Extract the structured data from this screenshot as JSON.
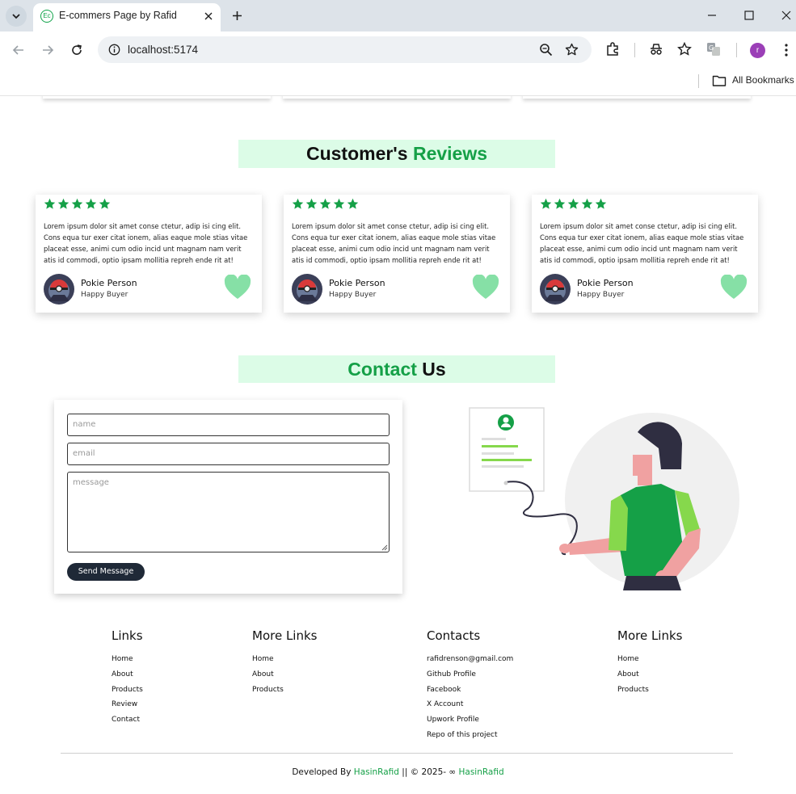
{
  "browser": {
    "tab_title": "E-commers Page by Rafid",
    "favicon_text": "Ec",
    "url": "localhost:5174",
    "bookmarks_label": "All Bookmarks",
    "profile_initial": "r"
  },
  "reviews": {
    "title_part1": "Customer's",
    "title_part2": "Reviews",
    "star_color": "#15a047",
    "cards": [
      {
        "rating": 5,
        "text": "Lorem ipsum dolor sit amet conse ctetur, adip isi cing elit. Cons equa tur exer citat ionem, alias eaque mole stias vitae placeat esse, animi cum odio incid unt magnam nam verit atis id commodi, optio ipsam mollitia repreh ende rit at!",
        "name": "Pokie Person",
        "role": "Happy Buyer"
      },
      {
        "rating": 5,
        "text": "Lorem ipsum dolor sit amet conse ctetur, adip isi cing elit. Cons equa tur exer citat ionem, alias eaque mole stias vitae placeat esse, animi cum odio incid unt magnam nam verit atis id commodi, optio ipsam mollitia repreh ende rit at!",
        "name": "Pokie Person",
        "role": "Happy Buyer"
      },
      {
        "rating": 5,
        "text": "Lorem ipsum dolor sit amet conse ctetur, adip isi cing elit. Cons equa tur exer citat ionem, alias eaque mole stias vitae placeat esse, animi cum odio incid unt magnam nam verit atis id commodi, optio ipsam mollitia repreh ende rit at!",
        "name": "Pokie Person",
        "role": "Happy Buyer"
      }
    ]
  },
  "contact": {
    "title_part1": "Contact",
    "title_part2": "Us",
    "name_placeholder": "name",
    "email_placeholder": "email",
    "message_placeholder": "message",
    "send_label": "Send Message"
  },
  "footer": {
    "columns": [
      {
        "heading": "Links",
        "items": [
          "Home",
          "About",
          "Products",
          "Review",
          "Contact"
        ]
      },
      {
        "heading": "More Links",
        "items": [
          "Home",
          "About",
          "Products"
        ]
      },
      {
        "heading": "Contacts",
        "items": [
          "rafidrenson@gmail.com",
          "Github Profile",
          "Facebook",
          "X Account",
          "Upwork Profile",
          "Repo of this project"
        ]
      },
      {
        "heading": "More Links",
        "items": [
          "Home",
          "About",
          "Products"
        ]
      }
    ],
    "credit_prefix": "Developed By",
    "credit_name1": "HasinRafid",
    "credit_middle": "|| © 2025- ∞",
    "credit_name2": "HasinRafid"
  },
  "colors": {
    "accent_green": "#15a047",
    "title_bg": "#dcfce7",
    "heart": "#86e0a6",
    "button_dark": "#1f2937"
  }
}
